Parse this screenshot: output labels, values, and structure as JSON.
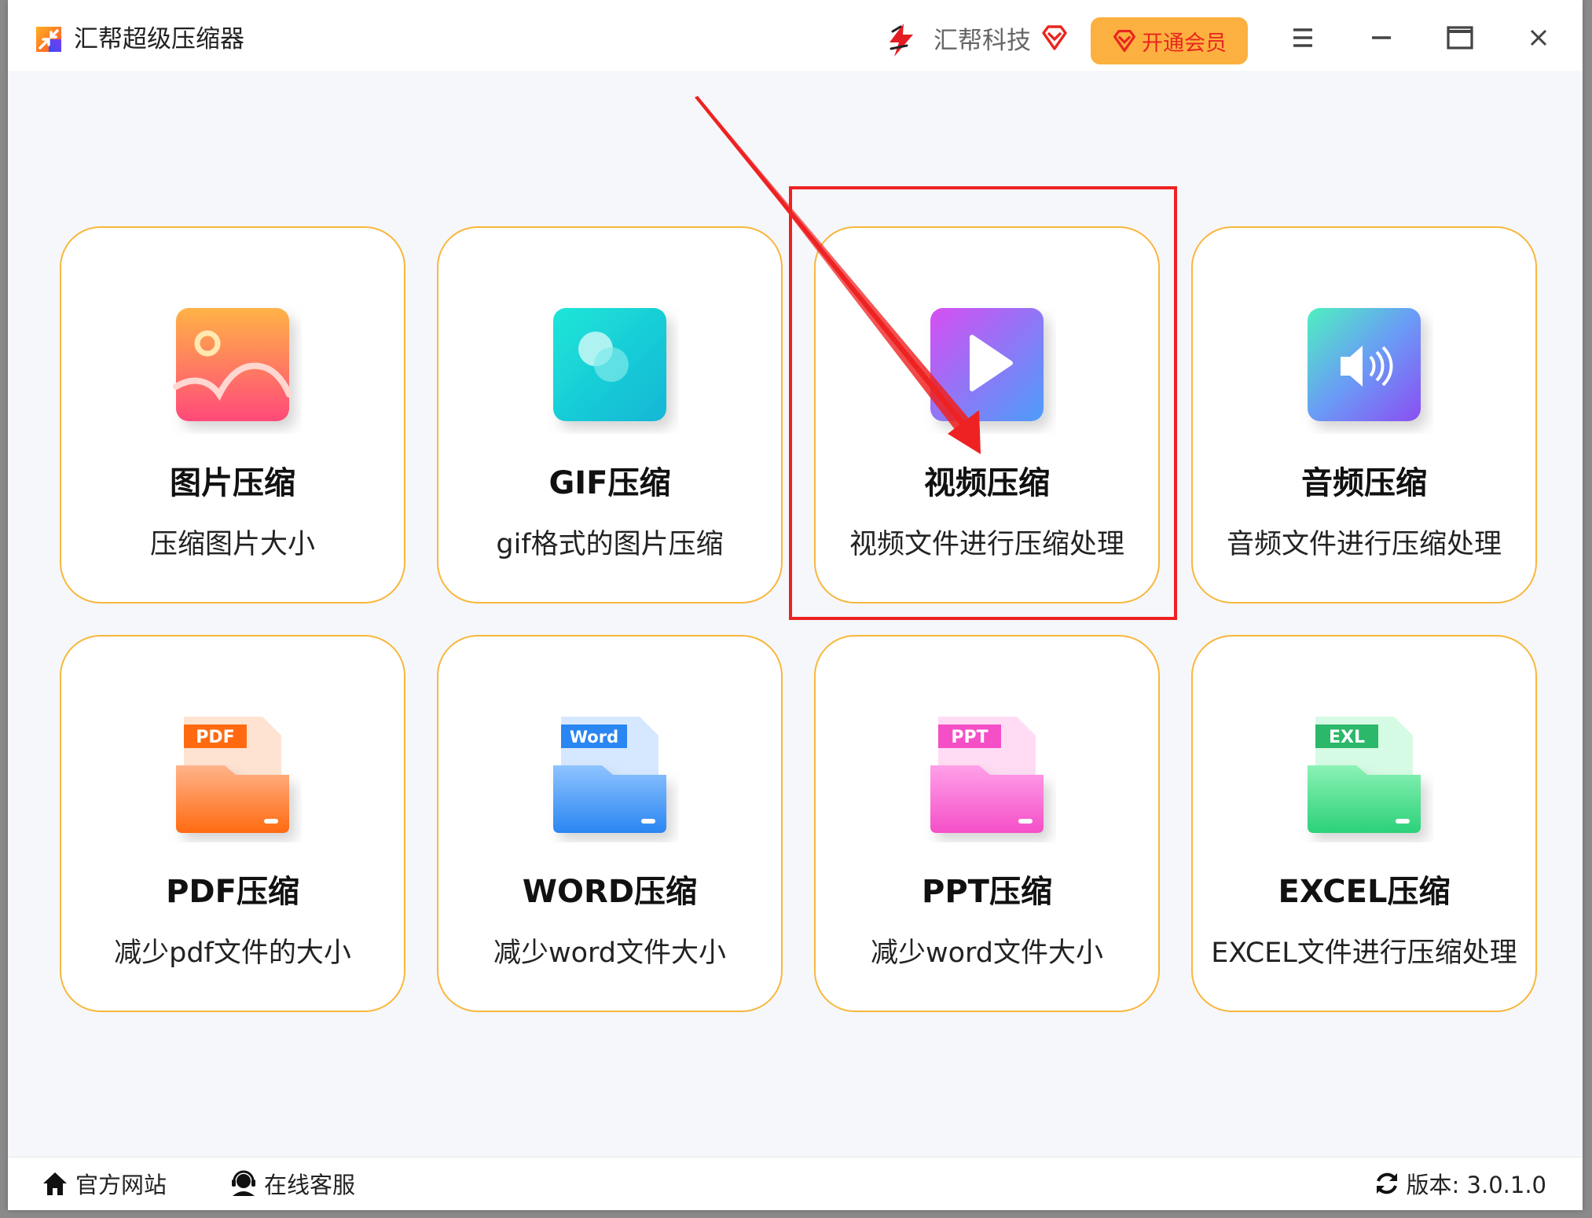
{
  "window": {
    "title": "汇帮超级压缩器",
    "brand_name": "汇帮科技",
    "vip_label": "开通会员"
  },
  "cards": [
    {
      "title": "图片压缩",
      "desc": "压缩图片大小",
      "icon": "image-icon"
    },
    {
      "title": "GIF压缩",
      "desc": "gif格式的图片压缩",
      "icon": "gif-icon"
    },
    {
      "title": "视频压缩",
      "desc": "视频文件进行压缩处理",
      "icon": "video-play-icon"
    },
    {
      "title": "音频压缩",
      "desc": "音频文件进行压缩处理",
      "icon": "audio-speaker-icon"
    },
    {
      "title": "PDF压缩",
      "desc": "减少pdf文件的大小",
      "icon": "pdf-folder-icon",
      "tag": "PDF"
    },
    {
      "title": "WORD压缩",
      "desc": "减少word文件大小",
      "icon": "word-folder-icon",
      "tag": "Word"
    },
    {
      "title": "PPT压缩",
      "desc": "减少word文件大小",
      "icon": "ppt-folder-icon",
      "tag": "PPT"
    },
    {
      "title": "EXCEL压缩",
      "desc": "EXCEL文件进行压缩处理",
      "icon": "excel-folder-icon",
      "tag": "EXL"
    }
  ],
  "footer": {
    "website_label": "官方网站",
    "support_label": "在线客服",
    "version_label": "版本:  3.0.1.0"
  },
  "colors": {
    "card_border": "#f8b73c",
    "vip_bg": "#fcb040",
    "highlight": "#ee2222"
  }
}
